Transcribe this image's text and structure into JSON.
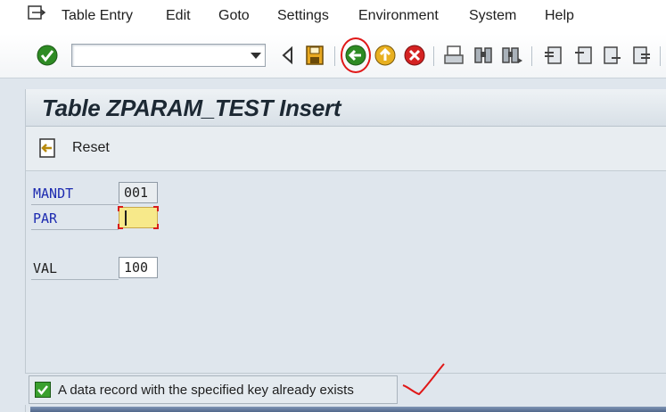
{
  "menubar": {
    "items": [
      {
        "label": "Table Entry"
      },
      {
        "label": "Edit"
      },
      {
        "label": "Goto"
      },
      {
        "label": "Settings"
      },
      {
        "label": "Environment"
      },
      {
        "label": "System"
      },
      {
        "label": "Help"
      }
    ]
  },
  "toolbar": {
    "command_field_value": "",
    "icons": [
      "enter-icon",
      "command-dropdown-icon",
      "expand-left-icon",
      "save-icon",
      "back-icon",
      "exit-icon",
      "cancel-icon",
      "print-icon",
      "find-icon",
      "find-next-icon",
      "first-page-icon",
      "previous-page-icon",
      "next-page-icon",
      "last-page-icon"
    ]
  },
  "screen": {
    "title": "Table ZPARAM_TEST Insert",
    "reset_label": "Reset"
  },
  "form": {
    "fields": [
      {
        "label": "MANDT",
        "value": "001",
        "key": true,
        "readonly": true
      },
      {
        "label": "PAR",
        "value": "",
        "key": true,
        "focused": true
      },
      {
        "label": "VAL",
        "value": "100",
        "key": false
      }
    ]
  },
  "status": {
    "message": "A data record with the specified key already exists",
    "type": "success-icon"
  },
  "colors": {
    "key_label": "#1d2bb0",
    "focus_field": "#f7e98a",
    "annotation_red": "#e01818",
    "enter_green": "#2e8b24"
  }
}
